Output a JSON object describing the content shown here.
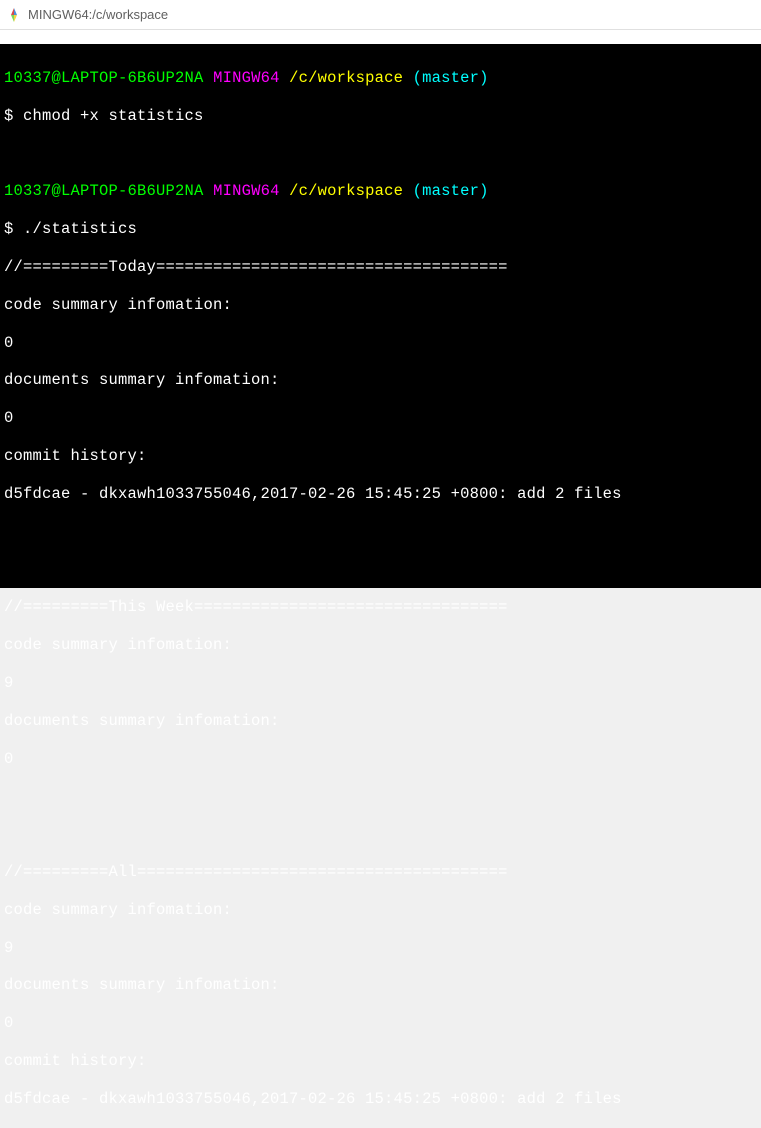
{
  "window": {
    "title": "MINGW64:/c/workspace"
  },
  "prompt1": {
    "userhost": "10337@LAPTOP-6B6UP2NA",
    "env": "MINGW64",
    "path": "/c/workspace",
    "branch": "(master)",
    "symbol": "$",
    "command": "chmod +x statistics"
  },
  "prompt2": {
    "userhost": "10337@LAPTOP-6B6UP2NA",
    "env": "MINGW64",
    "path": "/c/workspace",
    "branch": "(master)",
    "symbol": "$",
    "command": "./statistics"
  },
  "output": {
    "section1_header": "//=========Today=====================================",
    "section1_code_label": "code summary infomation:",
    "section1_code_val": "0",
    "section1_docs_label": "documents summary infomation:",
    "section1_docs_val": "0",
    "section1_commit_label": "commit history:",
    "section1_commit_entry": "d5fdcae - dkxawh1033755046,2017-02-26 15:45:25 +0800: add 2 files",
    "section2_header": "//=========This Week=================================",
    "section2_code_label": "code summary infomation:",
    "section2_code_val": "9",
    "section2_docs_label": "documents summary infomation:",
    "section2_docs_val": "0",
    "section3_header": "//=========All=======================================",
    "section3_code_label": "code summary infomation:",
    "section3_code_val": "9",
    "section3_docs_label": "documents summary infomation:",
    "section3_docs_val": "0",
    "section3_commit_label": "commit history:",
    "section3_commit_entry": "d5fdcae - dkxawh1033755046,2017-02-26 15:45:25 +0800: add 2 files"
  }
}
